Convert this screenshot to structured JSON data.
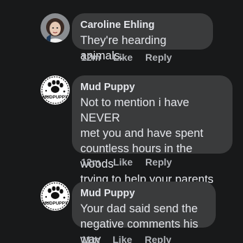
{
  "comments": [
    {
      "author": "Caroline Ehling",
      "text": "They're hearding animals.",
      "time": "12m",
      "like_label": "Like",
      "reply_label": "Reply"
    },
    {
      "author": "Mud Puppy",
      "avatar_text": "MUDPUPPY",
      "text": "Not to mention i have NEVER\nmet you and have spent\ncountless hours in the woods\ntrying to help your parents",
      "time": "12m",
      "like_label": "Like",
      "reply_label": "Reply"
    },
    {
      "author": "Mud Puppy",
      "avatar_text": "MUDPUPPY",
      "text": "Your dad said send the\nnegative comments  his way",
      "time": "11m",
      "like_label": "Like",
      "reply_label": "Reply"
    }
  ],
  "colors": {
    "background": "#18191a",
    "bubble": "#3a3b3c",
    "primary_text": "#e4e6eb",
    "secondary_text": "#b0b3b8"
  }
}
